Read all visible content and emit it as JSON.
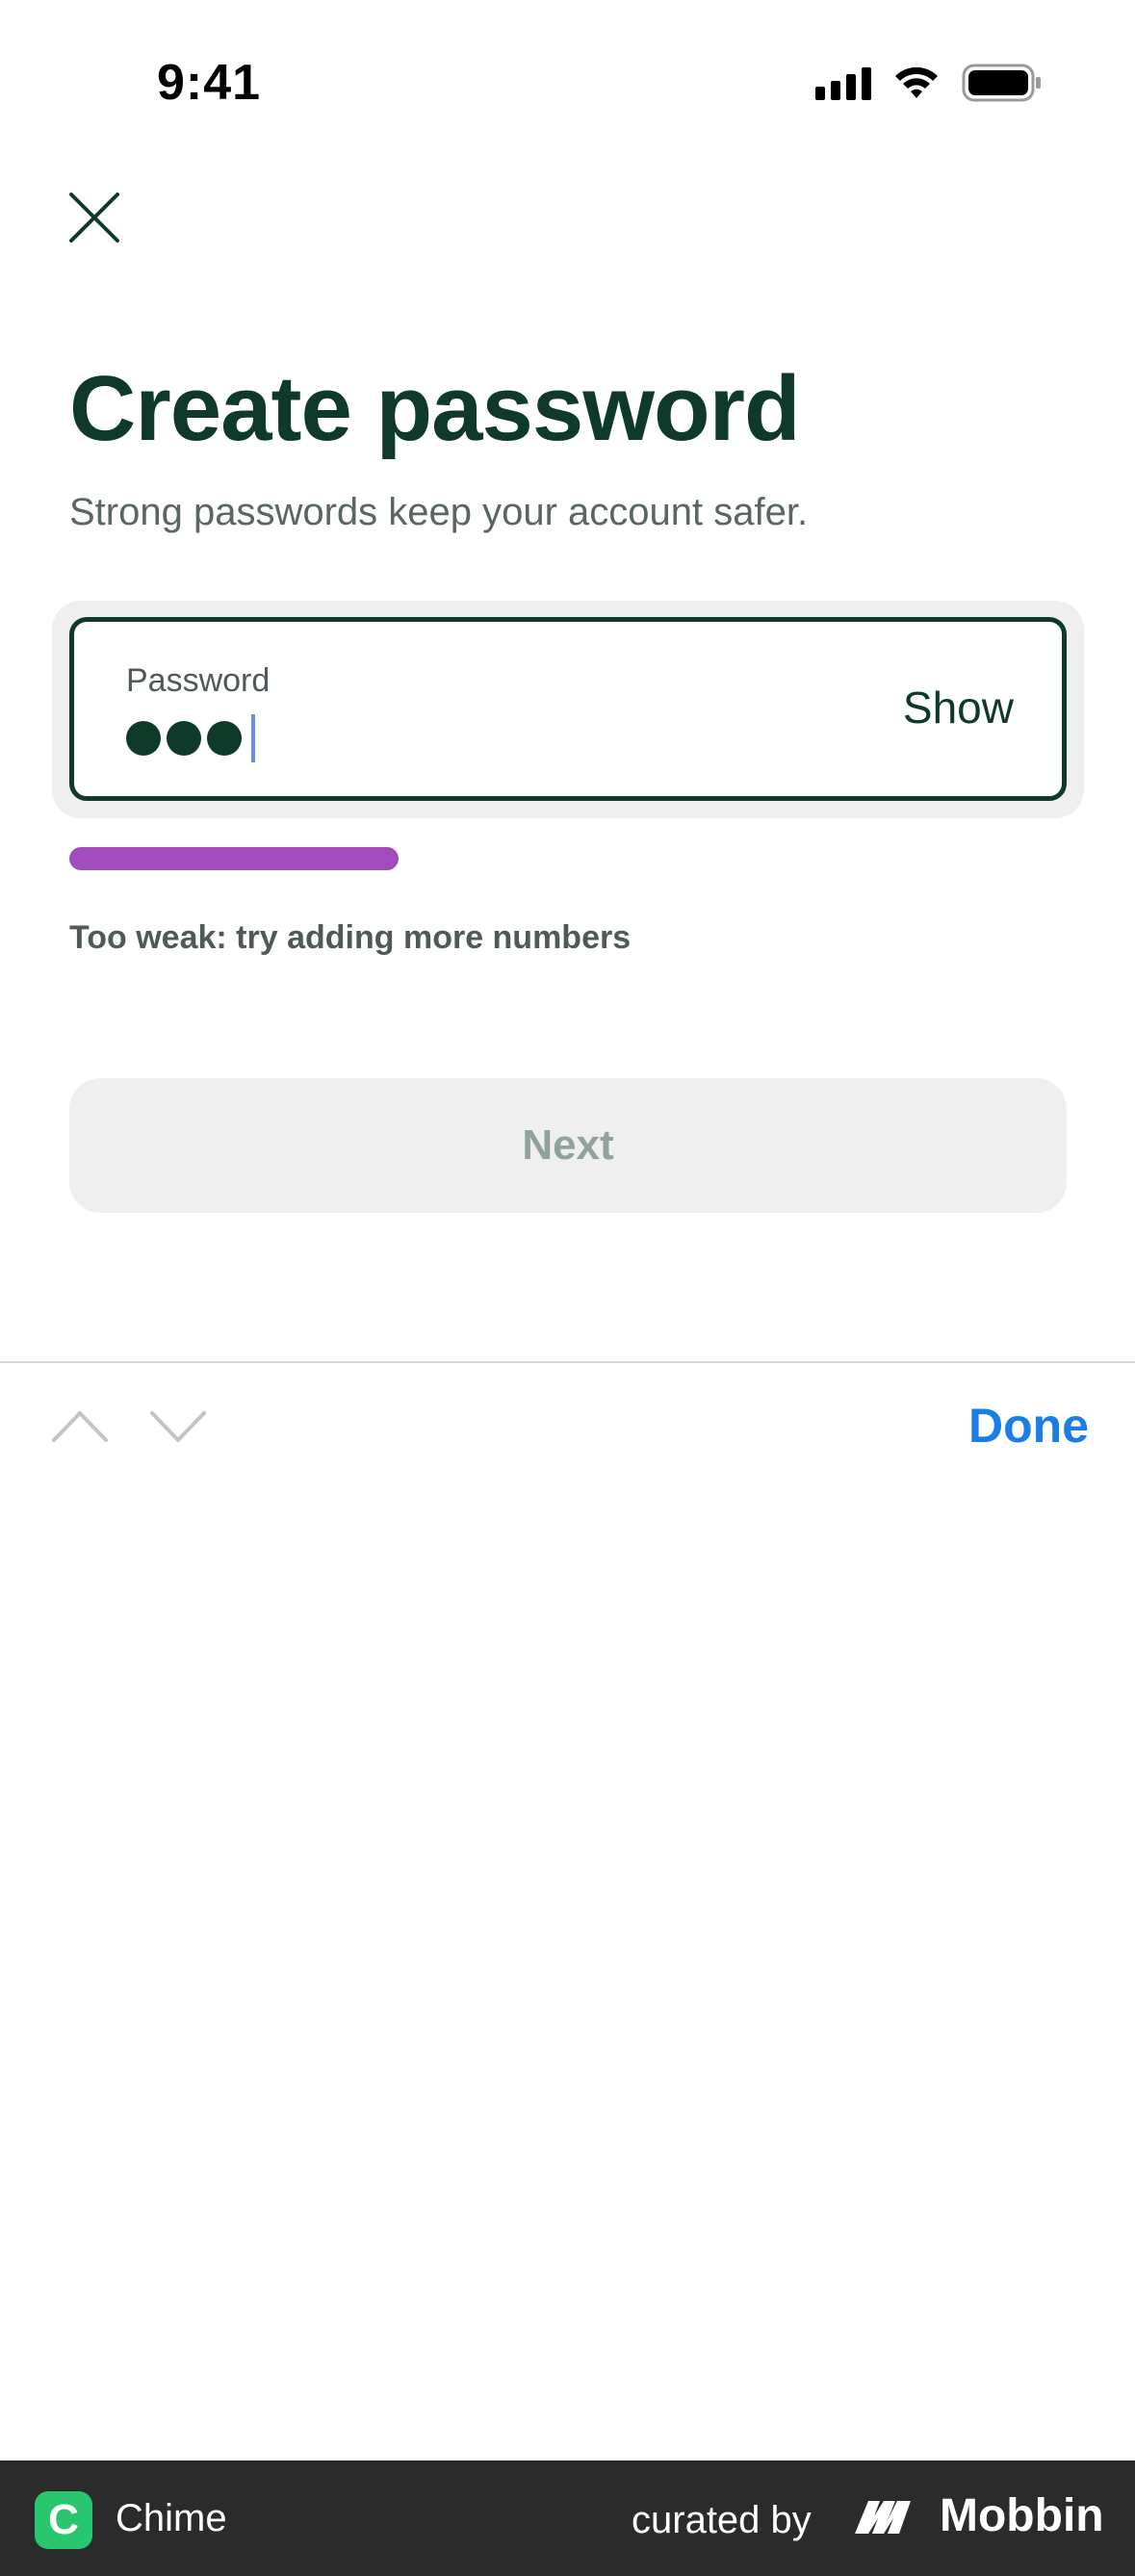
{
  "status_bar": {
    "time": "9:41"
  },
  "header": {
    "close_icon": "close-icon"
  },
  "content": {
    "title": "Create password",
    "subtitle": "Strong passwords keep your account safer."
  },
  "password_field": {
    "label": "Password",
    "masked_chars": 3,
    "show_label": "Show"
  },
  "strength": {
    "level_fraction": 0.33,
    "color": "#a24bbd",
    "hint": "Too weak: try adding more numbers"
  },
  "actions": {
    "next_label": "Next",
    "next_enabled": false
  },
  "keyboard_toolbar": {
    "done_label": "Done"
  },
  "footer": {
    "app_name": "Chime",
    "app_logo_letter": "C",
    "curated_by": "curated by",
    "brand": "Mobbin"
  },
  "colors": {
    "primary": "#0f3a2a",
    "accent_link": "#1a7ee6",
    "muted": "#5a6662",
    "disabled_bg": "#efefef",
    "disabled_text": "#8fa39c"
  }
}
